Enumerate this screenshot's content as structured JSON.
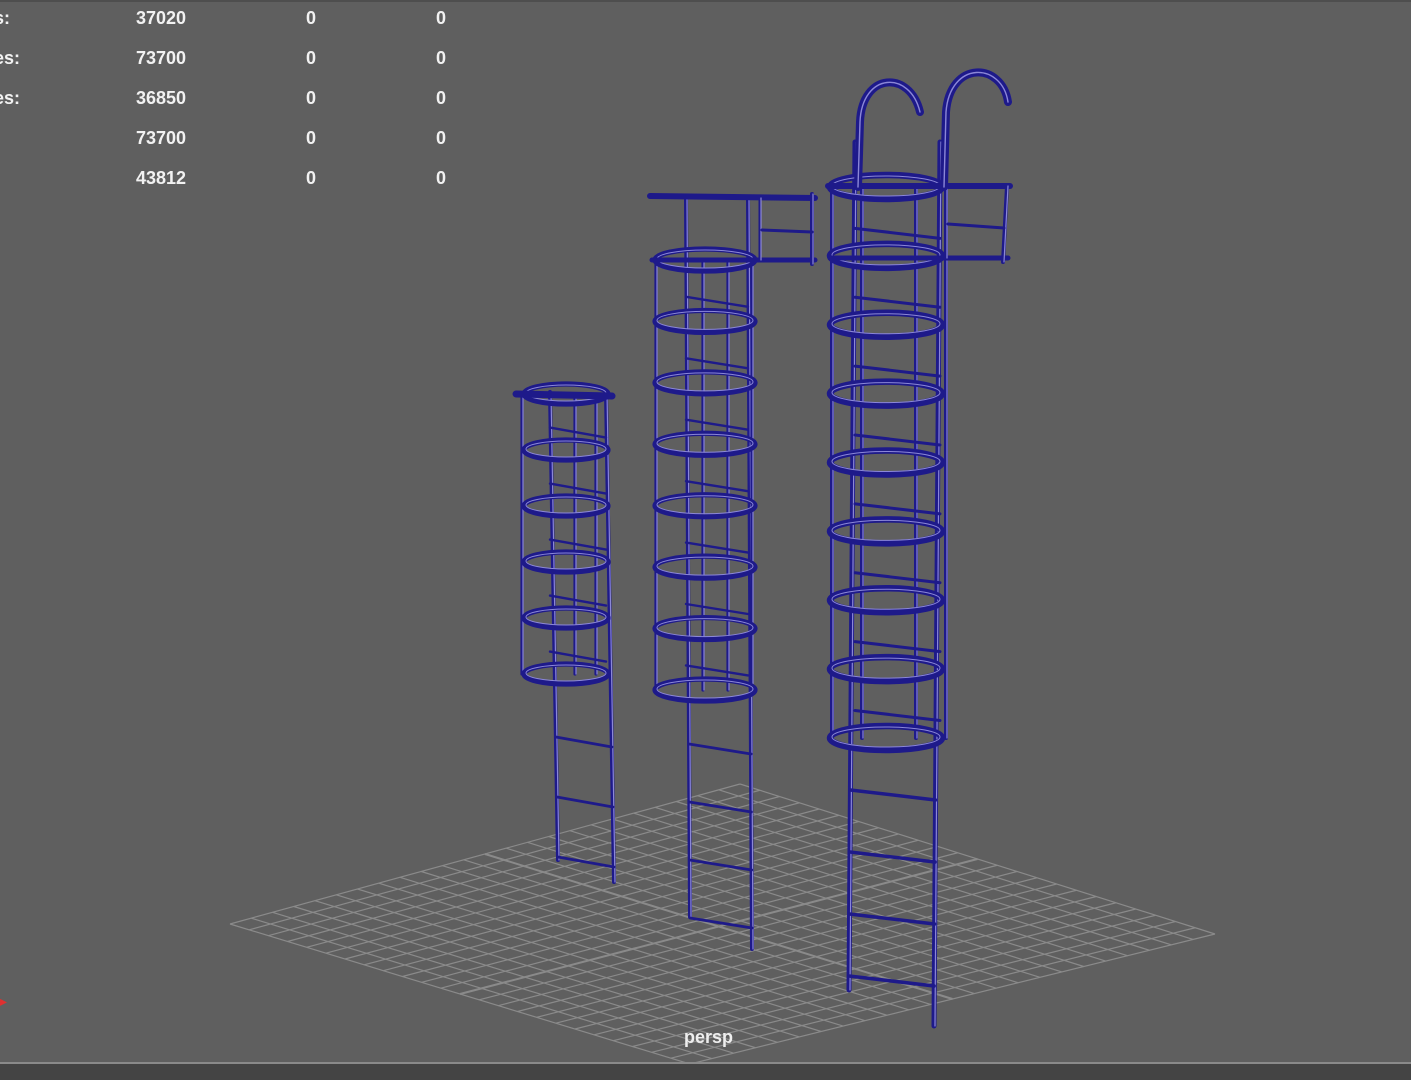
{
  "viewport": {
    "camera_label": "persp",
    "background_color": "#5f5f5f",
    "grid_color": "#8a8a8a",
    "mesh_color": "#1e1a8a",
    "mesh_highlight_color": "#8b87d8"
  },
  "hud": {
    "rows": [
      {
        "label": "s:",
        "total": "37020",
        "selected": "0",
        "tris": "0"
      },
      {
        "label": "es:",
        "total": "73700",
        "selected": "0",
        "tris": "0"
      },
      {
        "label": "es:",
        "total": "36850",
        "selected": "0",
        "tris": "0"
      },
      {
        "label": "",
        "total": "73700",
        "selected": "0",
        "tris": "0"
      },
      {
        "label": ":",
        "total": "43812",
        "selected": "0",
        "tris": "0"
      }
    ]
  },
  "axis_indicator": {
    "label": "",
    "color": "#e03030"
  }
}
